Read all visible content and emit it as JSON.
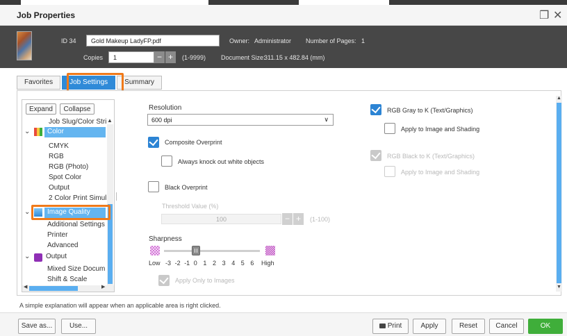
{
  "dialog": {
    "title": "Job Properties",
    "restore_glyph": "❐",
    "close_glyph": "✕"
  },
  "job": {
    "id_label": "ID 34",
    "file_name": "Gold Makeup LadyFP.pdf",
    "owner_label": "Owner:",
    "owner_value": "Administrator",
    "pages_label": "Number of Pages:",
    "pages_value": "1",
    "copies_label": "Copies",
    "copies_value": "1",
    "copies_range": "(1-9999)",
    "doc_size_label": "Document Size:",
    "doc_size_value": "311.15 x 482.84 (mm)"
  },
  "tabs": [
    {
      "label": "Favorites"
    },
    {
      "label": "Job Settings",
      "active": true
    },
    {
      "label": "Summary"
    }
  ],
  "tree": {
    "expand_label": "Expand",
    "collapse_label": "Collapse",
    "items": [
      "Job Slug/Color Stri",
      "Color",
      "CMYK",
      "RGB",
      "RGB (Photo)",
      "Spot Color",
      "Output",
      "2 Color Print Simul",
      "Image Quality",
      "Additional Settings",
      "Printer",
      "Advanced",
      "Output",
      "Mixed Size Docum",
      "Shift & Scale"
    ]
  },
  "settings": {
    "resolution_label": "Resolution",
    "resolution_value": "600 dpi",
    "composite_overprint": "Composite Overprint",
    "knockout_white": "Always knock out white objects",
    "black_overprint": "Black Overprint",
    "threshold_label": "Threshold Value (%)",
    "threshold_value": "100",
    "threshold_range": "(1-100)",
    "sharpness_label": "Sharpness",
    "sharpness_low": "Low",
    "sharpness_high": "High",
    "sharpness_ticks": [
      "-3",
      "-2",
      "-1",
      "0",
      "1",
      "2",
      "3",
      "4",
      "5",
      "6"
    ],
    "sharpness_level": 0,
    "apply_images_only": "Apply Only to Images",
    "rgb_gray_to_k": "RGB Gray to K (Text/Graphics)",
    "apply_image_shading_1": "Apply to Image and Shading",
    "rgb_black_to_k": "RGB Black to K (Text/Graphics)",
    "apply_image_shading_2": "Apply to Image and Shading"
  },
  "status_text": "A simple explanation will appear when an applicable area is right clicked.",
  "footer": {
    "save_as": "Save as...",
    "use": "Use...",
    "print": "Print",
    "apply": "Apply",
    "reset": "Reset",
    "cancel": "Cancel",
    "ok": "OK"
  },
  "colors": {
    "accent_blue": "#2f8ad8",
    "highlight_orange": "#f07a1a",
    "ok_green": "#3fae3a",
    "info_bar": "#474747"
  }
}
